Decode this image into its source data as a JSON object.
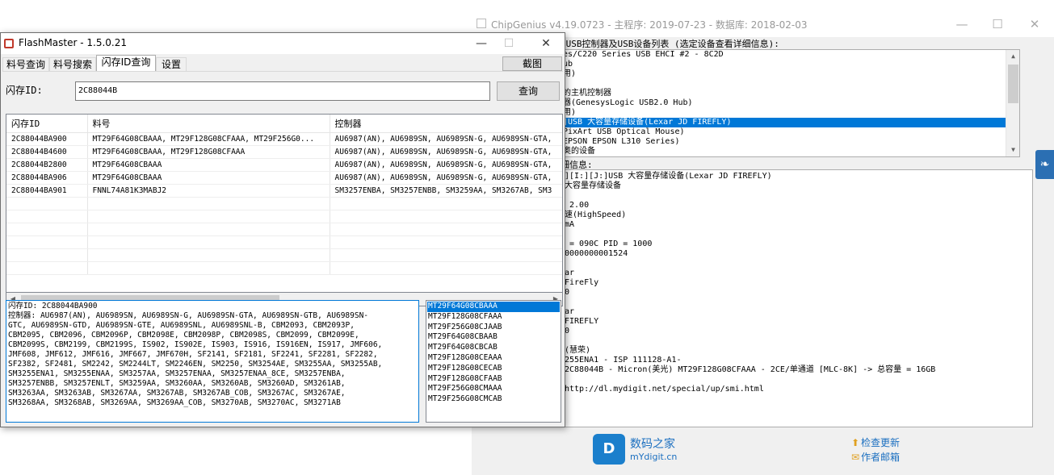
{
  "chipgenius": {
    "title": "ChipGenius v4.19.0723 - 主程序: 2019-07-23 - 数据库: 2018-02-03",
    "controls": {
      "minimize": "—",
      "maximize": "☐",
      "close": "✕"
    },
    "devlist_header": "]USB控制器及USB设备列表 (选定设备查看详细信息):",
    "devlist": [
      "es/C220 Series USB EHCI #2 - 8C2D",
      "ub",
      "用)",
      "",
      "的主机控制器",
      "器(GenesysLogic USB2.0 Hub)",
      "用)",
      "]USB 大容量存储设备(Lexar JD FIREFLY)",
      "PixArt USB Optical Mouse)",
      "EPSON EPSON L310 Series)",
      "奥的设备"
    ],
    "devlist_selected_index": 7,
    "detail_header": "细信息:",
    "detail": [
      "][I:][J:]USB 大容量存储设备(Lexar JD FIREFLY)",
      "大容量存储设备",
      "",
      " 2.00",
      "速(HighSpeed)",
      "mA",
      "",
      " = 090C PID = 1000",
      "0000000001524",
      "",
      "ar",
      "FireFly",
      "0",
      "",
      "ar",
      "FIREFLY",
      "0",
      "",
      "(慧荣)",
      "255ENA1 - ISP 111128-A1-",
      "2C88044B - Micron(美光) MT29F128G08CFAAA - 2CE/单通道 [MLC-8K] -> 总容量 = 16GB",
      "",
      "http://dl.mydigit.net/special/up/smi.html"
    ],
    "footer": {
      "logo_glyph": "D",
      "brand": "数码之家",
      "brand_url": "mYdigit.cn",
      "update": "检查更新",
      "mail": "作者邮箱",
      "update_icon": "⬆",
      "mail_icon": "✉"
    },
    "side_tab_glyph": "❧"
  },
  "flashmaster": {
    "title": "FlashMaster - 1.5.0.21",
    "controls": {
      "minimize": "—",
      "maximize": "☐",
      "close": "✕"
    },
    "tabs": [
      "料号查询",
      "料号搜索",
      "闪存ID查询",
      "设置"
    ],
    "active_tab_index": 2,
    "screenshot_button": "截图",
    "id_label": "闪存ID:",
    "id_value": "2C88044B",
    "query_button": "查询",
    "table": {
      "headers": [
        "闪存ID",
        "料号",
        "控制器"
      ],
      "rows": [
        [
          "2C88044BA900",
          "MT29F64G08CBAAA, MT29F128G08CFAAA, MT29F256G0...",
          "AU6987(AN), AU6989SN, AU6989SN-G, AU6989SN-GTA,"
        ],
        [
          "2C88044B4600",
          "MT29F64G08CBAAA, MT29F128G08CFAAA",
          "AU6987(AN), AU6989SN, AU6989SN-G, AU6989SN-GTA,"
        ],
        [
          "2C88044B2800",
          "MT29F64G08CBAAA",
          "AU6987(AN), AU6989SN, AU6989SN-G, AU6989SN-GTA,"
        ],
        [
          "2C88044BA906",
          "MT29F64G08CBAAA",
          "AU6987(AN), AU6989SN, AU6989SN-G, AU6989SN-GTA,"
        ],
        [
          "2C88044BA901",
          "FNNL74A81K3MABJ2",
          "SM3257ENBA, SM3257ENBB, SM3259AA, SM3267AB, SM3"
        ],
        [
          "",
          "",
          ""
        ],
        [
          "",
          "",
          ""
        ],
        [
          "",
          "",
          ""
        ],
        [
          "",
          "",
          ""
        ],
        [
          "",
          "",
          ""
        ],
        [
          "",
          "",
          ""
        ]
      ]
    },
    "info": [
      "闪存ID: 2C88044BA900",
      "控制器: AU6987(AN), AU6989SN, AU6989SN-G, AU6989SN-GTA, AU6989SN-GTB, AU6989SN-",
      "GTC, AU6989SN-GTD, AU6989SN-GTE, AU6989SNL, AU6989SNL-B, CBM2093, CBM2093P,",
      "CBM2095, CBM2096, CBM2096P, CBM2098E, CBM2098P, CBM2098S, CBM2099, CBM2099E,",
      "CBM2099S, CBM2199, CBM2199S, IS902, IS902E, IS903, IS916, IS916EN, IS917, JMF606,",
      "JMF608, JMF612, JMF616, JMF667, JMF670H, SF2141, SF2181, SF2241, SF2281, SF2282,",
      "SF2382, SF2481, SM2242, SM2244LT, SM2246EN, SM2250, SM3254AE, SM3255AA, SM3255AB,",
      "SM3255ENA1, SM3255ENAA, SM3257AA, SM3257ENAA, SM3257ENAA_8CE, SM3257ENBA,",
      "SM3257ENBB, SM3257ENLT, SM3259AA, SM3260AA, SM3260AB, SM3260AD, SM3261AB,",
      "SM3263AA, SM3263AB, SM3267AA, SM3267AB, SM3267AB_COB, SM3267AC, SM3267AE,",
      "SM3268AA, SM3268AB, SM3269AA, SM3269AA_COB, SM3270AB, SM3270AC, SM3271AB"
    ],
    "parts": [
      "MT29F64G08CBAAA",
      "MT29F128G08CFAAA",
      "MT29F256G08CJAAB",
      "MT29F64G08CBAAB",
      "MT29F64G08CBCAB",
      "MT29F128G08CEAAA",
      "MT29F128G08CECAB",
      "MT29F128G08CFAAB",
      "MT29F256G08CMAAA",
      "MT29F256G08CMCAB"
    ],
    "parts_selected_index": 0
  },
  "colors": {
    "selection": "#0078d7",
    "brand": "#1b6fc0"
  }
}
